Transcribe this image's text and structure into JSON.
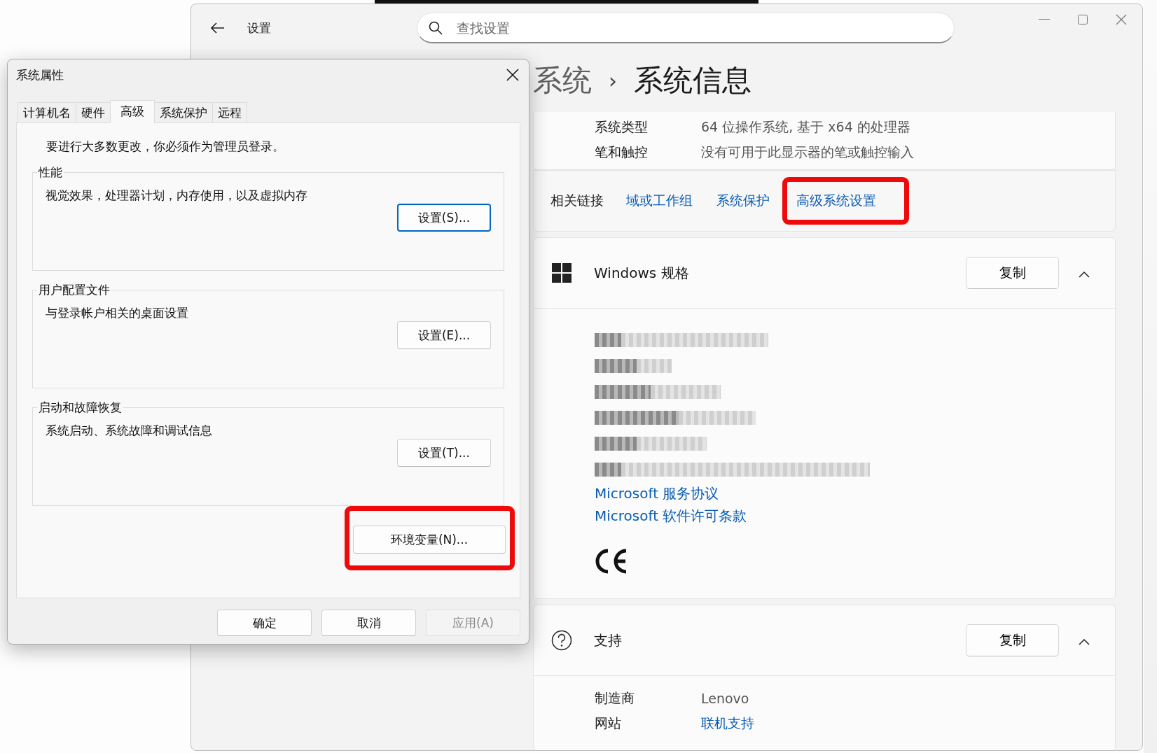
{
  "settings_window": {
    "title": "设置",
    "search": {
      "placeholder": "查找设置"
    },
    "breadcrumb": [
      "系统",
      "系统信息"
    ],
    "breadcrumb_separator": "›",
    "device_rows": [
      {
        "label": "系统类型",
        "value": "64 位操作系统, 基于 x64 的处理器"
      },
      {
        "label": "笔和触控",
        "value": "没有可用于此显示器的笔或触控输入"
      }
    ],
    "related_links": {
      "label": "相关链接",
      "links": [
        {
          "text": "域或工作组",
          "highlighted": false
        },
        {
          "text": "系统保护",
          "highlighted": false
        },
        {
          "text": "高级系统设置",
          "highlighted": true
        }
      ]
    },
    "windows_spec": {
      "title": "Windows 规格",
      "copy_button": "复制",
      "expanded": true,
      "links": [
        "Microsoft 服务协议",
        "Microsoft 软件许可条款"
      ]
    },
    "support": {
      "title": "支持",
      "copy_button": "复制",
      "expanded": true,
      "rows": [
        {
          "label": "制造商",
          "value": "Lenovo",
          "kind": "text"
        },
        {
          "label": "网站",
          "value": "联机支持",
          "kind": "link"
        }
      ]
    }
  },
  "dialog": {
    "title": "系统属性",
    "tabs": [
      {
        "label": "计算机名",
        "selected": false
      },
      {
        "label": "硬件",
        "selected": false
      },
      {
        "label": "高级",
        "selected": true
      },
      {
        "label": "系统保护",
        "selected": false
      },
      {
        "label": "远程",
        "selected": false
      }
    ],
    "notice": "要进行大多数更改，你必须作为管理员登录。",
    "groups": [
      {
        "title": "性能",
        "description": "视觉效果，处理器计划，内存使用，以及虚拟内存",
        "button": "设置(S)...",
        "focused": true
      },
      {
        "title": "用户配置文件",
        "description": "与登录帐户相关的桌面设置",
        "button": "设置(E)...",
        "focused": false
      },
      {
        "title": "启动和故障恢复",
        "description": "系统启动、系统故障和调试信息",
        "button": "设置(T)...",
        "focused": false
      }
    ],
    "env_button": {
      "label": "环境变量(N)...",
      "highlighted": true
    },
    "buttons": [
      {
        "label": "确定",
        "disabled": false
      },
      {
        "label": "取消",
        "disabled": false
      },
      {
        "label": "应用(A)",
        "disabled": true
      }
    ]
  }
}
